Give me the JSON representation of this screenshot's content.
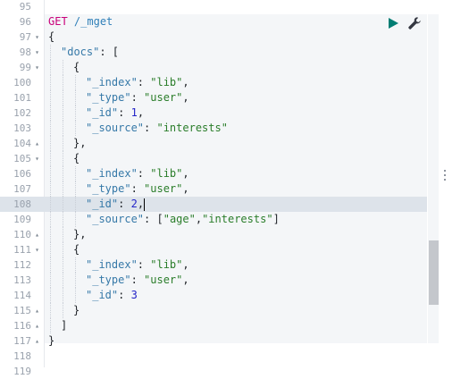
{
  "editor": {
    "lines": [
      {
        "num": "95",
        "fold": "",
        "indent": 0,
        "tokens": []
      },
      {
        "num": "96",
        "fold": "",
        "indent": 0,
        "tokens": [
          {
            "t": "method",
            "v": "GET"
          },
          {
            "t": "punc",
            "v": " "
          },
          {
            "t": "url",
            "v": "/_mget"
          }
        ]
      },
      {
        "num": "97",
        "fold": "▾",
        "indent": 0,
        "tokens": [
          {
            "t": "punc",
            "v": "{"
          }
        ]
      },
      {
        "num": "98",
        "fold": "▾",
        "indent": 1,
        "tokens": [
          {
            "t": "key",
            "v": "\"docs\""
          },
          {
            "t": "punc",
            "v": ": ["
          }
        ]
      },
      {
        "num": "99",
        "fold": "▾",
        "indent": 2,
        "tokens": [
          {
            "t": "punc",
            "v": "{"
          }
        ]
      },
      {
        "num": "100",
        "fold": "",
        "indent": 3,
        "tokens": [
          {
            "t": "key",
            "v": "\"_index\""
          },
          {
            "t": "punc",
            "v": ": "
          },
          {
            "t": "str",
            "v": "\"lib\""
          },
          {
            "t": "punc",
            "v": ","
          }
        ]
      },
      {
        "num": "101",
        "fold": "",
        "indent": 3,
        "tokens": [
          {
            "t": "key",
            "v": "\"_type\""
          },
          {
            "t": "punc",
            "v": ": "
          },
          {
            "t": "str",
            "v": "\"user\""
          },
          {
            "t": "punc",
            "v": ","
          }
        ]
      },
      {
        "num": "102",
        "fold": "",
        "indent": 3,
        "tokens": [
          {
            "t": "key",
            "v": "\"_id\""
          },
          {
            "t": "punc",
            "v": ": "
          },
          {
            "t": "num",
            "v": "1"
          },
          {
            "t": "punc",
            "v": ","
          }
        ]
      },
      {
        "num": "103",
        "fold": "",
        "indent": 3,
        "tokens": [
          {
            "t": "key",
            "v": "\"_source\""
          },
          {
            "t": "punc",
            "v": ": "
          },
          {
            "t": "str",
            "v": "\"interests\""
          }
        ]
      },
      {
        "num": "104",
        "fold": "▴",
        "indent": 2,
        "tokens": [
          {
            "t": "punc",
            "v": "},"
          }
        ]
      },
      {
        "num": "105",
        "fold": "▾",
        "indent": 2,
        "tokens": [
          {
            "t": "punc",
            "v": "{"
          }
        ]
      },
      {
        "num": "106",
        "fold": "",
        "indent": 3,
        "tokens": [
          {
            "t": "key",
            "v": "\"_index\""
          },
          {
            "t": "punc",
            "v": ": "
          },
          {
            "t": "str",
            "v": "\"lib\""
          },
          {
            "t": "punc",
            "v": ","
          }
        ]
      },
      {
        "num": "107",
        "fold": "",
        "indent": 3,
        "tokens": [
          {
            "t": "key",
            "v": "\"_type\""
          },
          {
            "t": "punc",
            "v": ": "
          },
          {
            "t": "str",
            "v": "\"user\""
          },
          {
            "t": "punc",
            "v": ","
          }
        ]
      },
      {
        "num": "108",
        "fold": "",
        "indent": 3,
        "active": true,
        "tokens": [
          {
            "t": "key",
            "v": "\"_id\""
          },
          {
            "t": "punc",
            "v": ": "
          },
          {
            "t": "num",
            "v": "2"
          },
          {
            "t": "punc",
            "v": ","
          }
        ]
      },
      {
        "num": "109",
        "fold": "",
        "indent": 3,
        "tokens": [
          {
            "t": "key",
            "v": "\"_source\""
          },
          {
            "t": "punc",
            "v": ": ["
          },
          {
            "t": "str",
            "v": "\"age\""
          },
          {
            "t": "punc",
            "v": ","
          },
          {
            "t": "str",
            "v": "\"interests\""
          },
          {
            "t": "punc",
            "v": "]"
          }
        ]
      },
      {
        "num": "110",
        "fold": "▴",
        "indent": 2,
        "tokens": [
          {
            "t": "punc",
            "v": "},"
          }
        ]
      },
      {
        "num": "111",
        "fold": "▾",
        "indent": 2,
        "tokens": [
          {
            "t": "punc",
            "v": "{"
          }
        ]
      },
      {
        "num": "112",
        "fold": "",
        "indent": 3,
        "tokens": [
          {
            "t": "key",
            "v": "\"_index\""
          },
          {
            "t": "punc",
            "v": ": "
          },
          {
            "t": "str",
            "v": "\"lib\""
          },
          {
            "t": "punc",
            "v": ","
          }
        ]
      },
      {
        "num": "113",
        "fold": "",
        "indent": 3,
        "tokens": [
          {
            "t": "key",
            "v": "\"_type\""
          },
          {
            "t": "punc",
            "v": ": "
          },
          {
            "t": "str",
            "v": "\"user\""
          },
          {
            "t": "punc",
            "v": ","
          }
        ]
      },
      {
        "num": "114",
        "fold": "",
        "indent": 3,
        "tokens": [
          {
            "t": "key",
            "v": "\"_id\""
          },
          {
            "t": "punc",
            "v": ": "
          },
          {
            "t": "num",
            "v": "3"
          }
        ]
      },
      {
        "num": "115",
        "fold": "▴",
        "indent": 2,
        "tokens": [
          {
            "t": "punc",
            "v": "}"
          }
        ]
      },
      {
        "num": "116",
        "fold": "▴",
        "indent": 1,
        "tokens": [
          {
            "t": "punc",
            "v": "]"
          }
        ]
      },
      {
        "num": "117",
        "fold": "▴",
        "indent": 0,
        "tokens": [
          {
            "t": "punc",
            "v": "}"
          }
        ]
      },
      {
        "num": "118",
        "fold": "",
        "indent": 0,
        "tokens": []
      },
      {
        "num": "119",
        "fold": "",
        "indent": 0,
        "tokens": []
      }
    ]
  },
  "toolbar": {
    "run_icon": "play-icon",
    "settings_icon": "wrench-icon",
    "run_color": "#017d73"
  },
  "colors": {
    "method": "#c9007a",
    "url": "#2f7fb8",
    "key": "#3679a8",
    "string": "#2a7d2a",
    "number": "#2424c8"
  }
}
